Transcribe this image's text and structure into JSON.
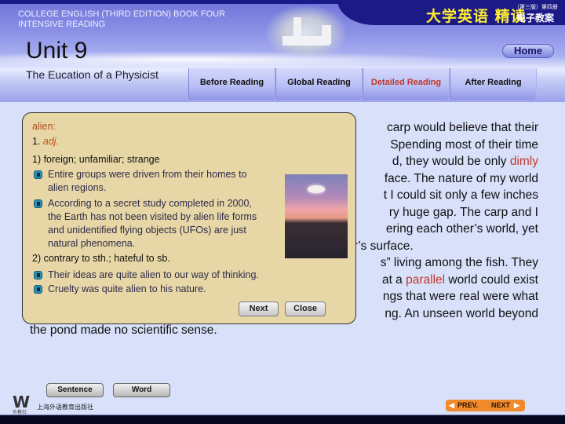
{
  "header": {
    "book_title_line1": "COLLEGE ENGLISH (THIRD EDITION) BOOK FOUR",
    "book_title_line2": "INTENSIVE READING",
    "cn_title": "大学英语 精读",
    "cn_edition": "（第三版）第四册",
    "cn_subtitle": "电子教案",
    "unit": "Unit 9",
    "lesson_title": "The Eucation of a Physicist",
    "home_label": "Home"
  },
  "tabs": [
    {
      "label": "Before Reading",
      "active": false
    },
    {
      "label": "Global Reading",
      "active": false
    },
    {
      "label": "Detailed Reading",
      "active": true
    },
    {
      "label": "After Reading",
      "active": false
    }
  ],
  "main_text": {
    "lines": [
      "carp would believe that their",
      "Spending most of their time",
      "d, they would be only ",
      "face. The nature of my world",
      "t I could sit only a few inches",
      "ry huge gap. The carp and I",
      "ering each other’s world, yet",
      "er’s surface.",
      "s” living among the fish. They",
      "at a ",
      "ngs that were real were what",
      "ng. An unseen world beyond"
    ],
    "highlight_dimly": "dimly",
    "highlight_parallel": "parallel",
    "after_parallel": " world could exist",
    "last_line": "the pond made no scientific sense."
  },
  "popup": {
    "word": "alien:",
    "sense_number": "1. ",
    "part_of_speech": "adj.",
    "definition1": "1) foreign; unfamiliar; strange",
    "examples1": [
      "Entire groups were driven from their homes to alien regions.",
      "According to a secret study completed in 2000, the Earth has not been visited by alien life forms and unidentified flying objects (UFOs) are just natural phenomena."
    ],
    "definition2": "2) contrary to sth.; hateful to sb.",
    "examples2": [
      "Their ideas are quite alien to our way of thinking.",
      "Cruelty was quite alien to his nature."
    ],
    "next_label": "Next",
    "close_label": "Close"
  },
  "bottom": {
    "sentence_label": "Sentence",
    "word_label": "Word",
    "logo_letter": "W",
    "logo_cn": "外教社",
    "publisher": "上海外语教育出版社",
    "prev_label": "PREV.",
    "next_label": "NEXT"
  }
}
